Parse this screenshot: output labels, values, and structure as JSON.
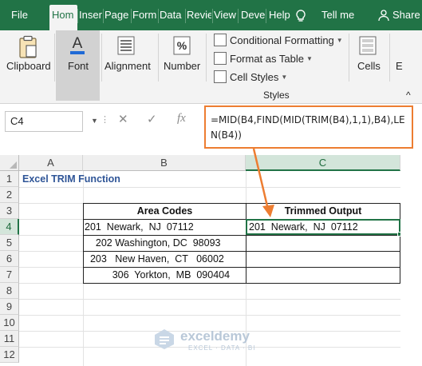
{
  "tabs": [
    "File",
    "Hom",
    "Inser",
    "Page",
    "Form",
    "Data",
    "Revie",
    "View",
    "Deve",
    "Help",
    "Tell me",
    "Share"
  ],
  "ribbon": {
    "clipboard": "Clipboard",
    "font": "Font",
    "alignment": "Alignment",
    "number": "Number",
    "conditional_formatting": "Conditional Formatting",
    "format_as_table": "Format as Table",
    "cell_styles": "Cell Styles",
    "styles": "Styles",
    "cells": "Cells",
    "editing": "E"
  },
  "formula_bar": {
    "name_box": "C4",
    "fx": "fx",
    "formula": "=MID(B4,FIND(MID(TRIM(B4),1,1),B4),LEN(B4))"
  },
  "grid": {
    "columns": [
      "A",
      "B",
      "C"
    ],
    "rows": [
      "1",
      "2",
      "3",
      "4",
      "5",
      "6",
      "7",
      "8",
      "9",
      "10",
      "11",
      "12"
    ],
    "title": "Excel TRIM Function",
    "headers": {
      "b3": "Area Codes",
      "c3": "Trimmed Output"
    },
    "b4": "201  Newark,  NJ  07112",
    "b5": "    202 Washington, DC  98093",
    "b6": "  203   New Haven,  CT   06002",
    "b7": "          306  Yorkton,  MB  090404",
    "c4": "201  Newark,  NJ  07112"
  },
  "watermark": {
    "name": "exceldemy",
    "tagline": "EXCEL · DATA · BI"
  },
  "colors": {
    "excel_green": "#217346",
    "callout_orange": "#ed7d31",
    "title_blue": "#2f5597"
  }
}
